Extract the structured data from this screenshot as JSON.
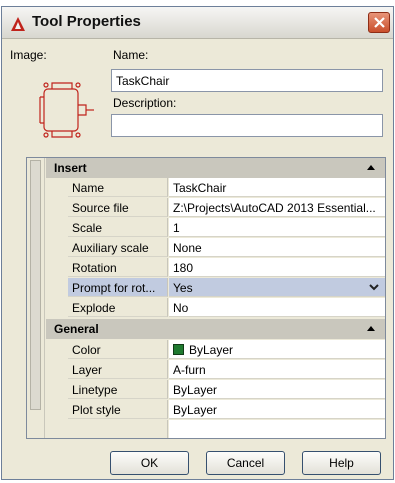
{
  "window": {
    "title": "Tool Properties"
  },
  "labels": {
    "image": "Image:",
    "name": "Name:",
    "description": "Description:"
  },
  "fields": {
    "name_value": "TaskChair",
    "description_value": ""
  },
  "categories": {
    "insert": {
      "title": "Insert",
      "rows": [
        {
          "name": "Name",
          "value": "TaskChair"
        },
        {
          "name": "Source file",
          "value": "Z:\\Projects\\AutoCAD 2013 Essential..."
        },
        {
          "name": "Scale",
          "value": "1"
        },
        {
          "name": "Auxiliary scale",
          "value": "None"
        },
        {
          "name": "Rotation",
          "value": "180"
        },
        {
          "name": "Prompt for rot...",
          "value": "Yes"
        },
        {
          "name": "Explode",
          "value": "No"
        }
      ]
    },
    "general": {
      "title": "General",
      "rows": [
        {
          "name": "Color",
          "value": "ByLayer"
        },
        {
          "name": "Layer",
          "value": "A-furn"
        },
        {
          "name": "Linetype",
          "value": "ByLayer"
        },
        {
          "name": "Plot style",
          "value": "ByLayer"
        }
      ]
    }
  },
  "buttons": {
    "ok": "OK",
    "cancel": "Cancel",
    "help": "Help"
  },
  "colors": {
    "swatch": "#1f7a2f",
    "selected_row": "#c1cbe0",
    "dialog_bg": "#ece9d8"
  }
}
